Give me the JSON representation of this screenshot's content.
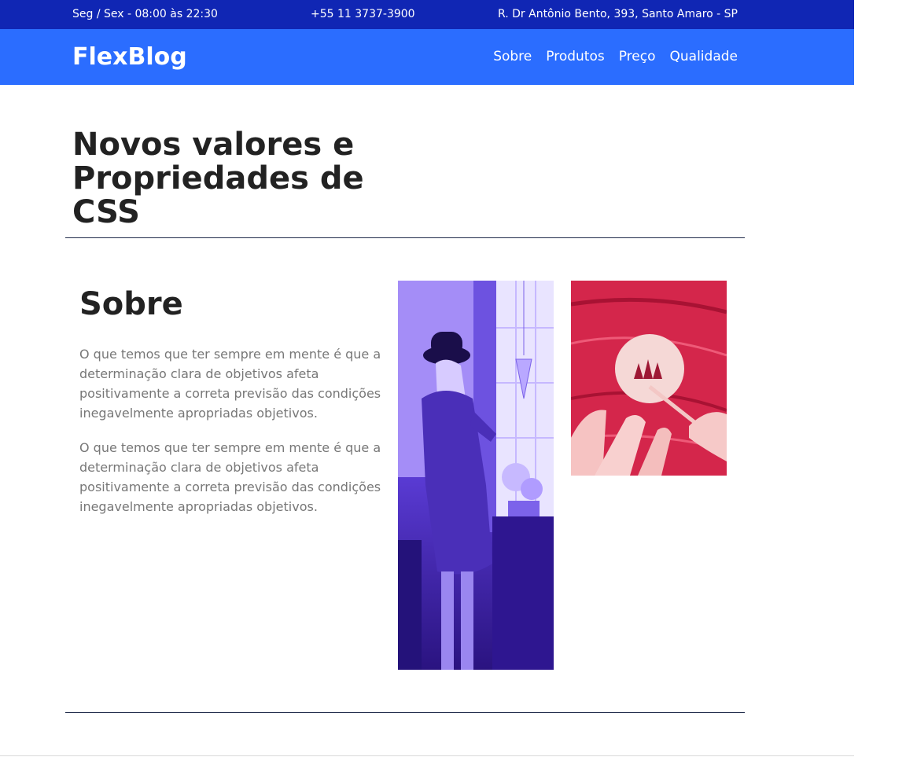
{
  "topbar": {
    "hours": "Seg / Sex - 08:00 às 22:30",
    "phone": "+55 11 3737-3900",
    "address": "R. Dr Antônio Bento, 393, Santo Amaro - SP"
  },
  "header": {
    "logo": "FlexBlog",
    "nav": [
      "Sobre",
      "Produtos",
      "Preço",
      "Qualidade"
    ]
  },
  "hero": {
    "title": "Novos valores e Propriedades de CSS"
  },
  "about": {
    "title": "Sobre",
    "paragraphs": [
      "O que temos que ter sempre em mente é que a determinação clara de objetivos afeta positivamente a correta previsão das condições inegavelmente apropriadas objetivos.",
      "O que temos que ter sempre em mente é que a determinação clara de objetivos afeta positivamente a correta previsão das condições inegavelmente apropriadas objetivos."
    ]
  },
  "colors": {
    "topbar": "#1026b4",
    "header": "#2b6dff",
    "image1_tint": "#5b3fd6",
    "image2_tint": "#e0345a"
  }
}
